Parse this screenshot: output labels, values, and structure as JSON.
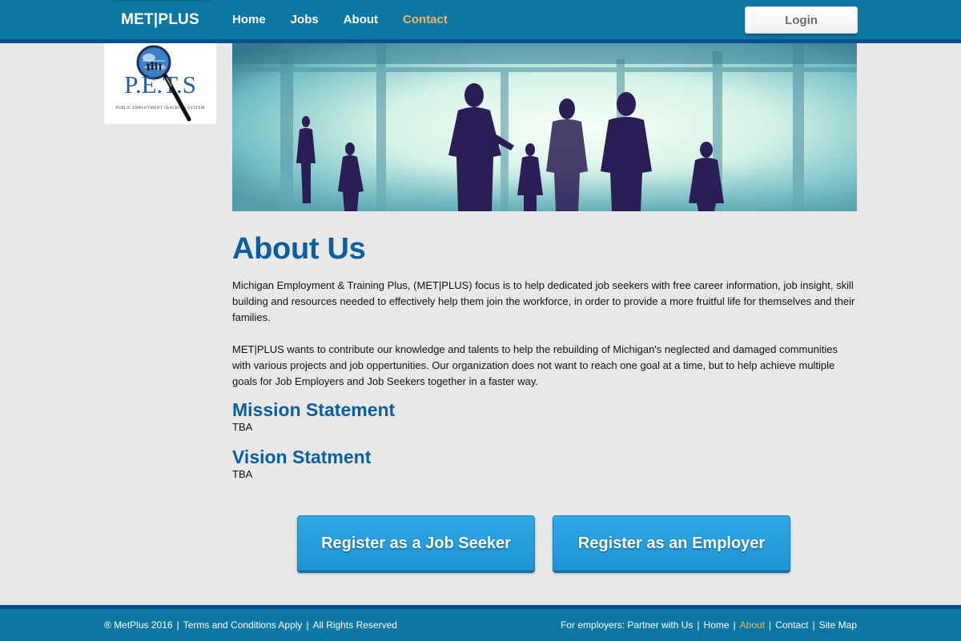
{
  "header": {
    "brand": "MET|PLUS",
    "nav": [
      {
        "label": "Home"
      },
      {
        "label": "Jobs"
      },
      {
        "label": "About"
      },
      {
        "label": "Contact"
      }
    ],
    "login_label": "Login",
    "active_color": "#f0b667",
    "bg_color": "#0d77a3"
  },
  "logo": {
    "text": "P.E.T.S",
    "subtitle": "PUBLIC EMPLOYMENT TRACKING SYSTEM"
  },
  "main": {
    "title": "About Us",
    "paragraphs": [
      "Michigan Employment & Training Plus, (MET|PLUS) focus is to help dedicated job seekers with free career information, job insight, skill building and resources needed to effectively help them join the workforce, in order to provide a more fruitful life for themselves and their families.",
      "MET|PLUS wants to contribute our knowledge and talents to help the rebuilding of Michigan's neglected and damaged communities with various projects and job oppertunities. Our organization does not want to reach one goal at a time, but to help achieve multiple goals for Job Employers and Job Seekers together in a faster way."
    ],
    "mission": {
      "heading": "Mission Statement",
      "text": "TBA"
    },
    "vision": {
      "heading": "Vision Statment",
      "text": "TBA"
    },
    "heading_color": "#0c5e9e"
  },
  "buttons": {
    "job_seeker": "Register as a Job Seeker",
    "employer": "Register as an Employer"
  },
  "footer": {
    "copyright": "® MetPlus 2016",
    "terms": "Terms and Conditions Apply",
    "rights": "All Rights Reserved",
    "links": [
      {
        "label": "For employers: Partner with Us"
      },
      {
        "label": "Home"
      },
      {
        "label": "About"
      },
      {
        "label": "Contact"
      },
      {
        "label": "Site Map"
      }
    ]
  }
}
